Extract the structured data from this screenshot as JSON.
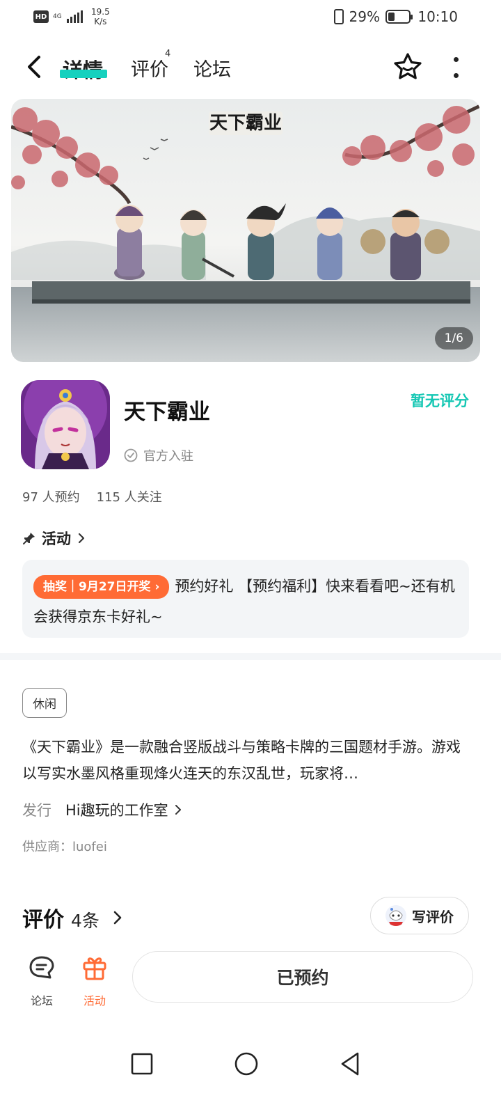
{
  "status_bar": {
    "hd": "HD",
    "network": "4G",
    "speed_value": "19.5",
    "speed_unit": "K/s",
    "battery": "29%",
    "battery_level": 0.29,
    "time": "10:10"
  },
  "top_nav": {
    "tabs": [
      {
        "label": "详情",
        "active": true
      },
      {
        "label": "评价",
        "badge": "4"
      },
      {
        "label": "论坛"
      }
    ]
  },
  "banner": {
    "logo_text": "天下霸业",
    "page_indicator": "1/6"
  },
  "game": {
    "title": "天下霸业",
    "official": "官方入驻",
    "rating": "暂无评分",
    "reservations": "97 人预约",
    "followers": "115 人关注"
  },
  "activity": {
    "heading": "活动",
    "tag": "抽奖｜9月27日开奖",
    "text": "预约好礼 【预约福利】快来看看吧~还有机会获得京东卡好礼~"
  },
  "details": {
    "category_tag": "休闲",
    "description": "《天下霸业》是一款融合竖版战斗与策略卡牌的三国题材手游。游戏以写实水墨风格重现烽火连天的东汉乱世，玩家将…",
    "publisher_label": "发行",
    "publisher_name": "Hi趣玩的工作室",
    "supplier": "供应商：luofei"
  },
  "reviews": {
    "title": "评价",
    "count": "4条",
    "write_label": "写评价"
  },
  "bottom_bar": {
    "forum_label": "论坛",
    "activity_label": "活动",
    "reserve_label": "已预约"
  },
  "colors": {
    "accent": "#16d1be",
    "rating": "#14c7b3",
    "orange": "#ff6b35"
  }
}
